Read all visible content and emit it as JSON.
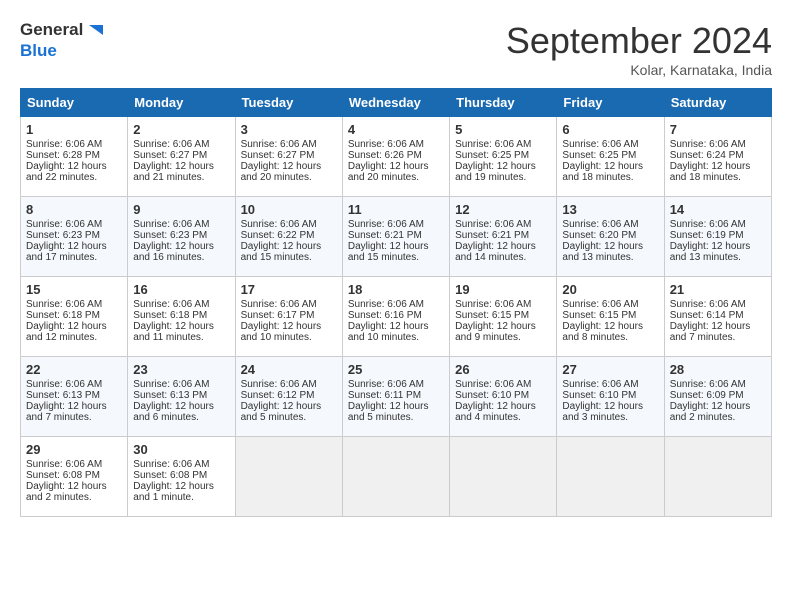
{
  "header": {
    "logo_general": "General",
    "logo_blue": "Blue",
    "month_title": "September 2024",
    "location": "Kolar, Karnataka, India"
  },
  "weekdays": [
    "Sunday",
    "Monday",
    "Tuesday",
    "Wednesday",
    "Thursday",
    "Friday",
    "Saturday"
  ],
  "weeks": [
    [
      {
        "day": "1",
        "lines": [
          "Sunrise: 6:06 AM",
          "Sunset: 6:28 PM",
          "Daylight: 12 hours",
          "and 22 minutes."
        ]
      },
      {
        "day": "2",
        "lines": [
          "Sunrise: 6:06 AM",
          "Sunset: 6:27 PM",
          "Daylight: 12 hours",
          "and 21 minutes."
        ]
      },
      {
        "day": "3",
        "lines": [
          "Sunrise: 6:06 AM",
          "Sunset: 6:27 PM",
          "Daylight: 12 hours",
          "and 20 minutes."
        ]
      },
      {
        "day": "4",
        "lines": [
          "Sunrise: 6:06 AM",
          "Sunset: 6:26 PM",
          "Daylight: 12 hours",
          "and 20 minutes."
        ]
      },
      {
        "day": "5",
        "lines": [
          "Sunrise: 6:06 AM",
          "Sunset: 6:25 PM",
          "Daylight: 12 hours",
          "and 19 minutes."
        ]
      },
      {
        "day": "6",
        "lines": [
          "Sunrise: 6:06 AM",
          "Sunset: 6:25 PM",
          "Daylight: 12 hours",
          "and 18 minutes."
        ]
      },
      {
        "day": "7",
        "lines": [
          "Sunrise: 6:06 AM",
          "Sunset: 6:24 PM",
          "Daylight: 12 hours",
          "and 18 minutes."
        ]
      }
    ],
    [
      {
        "day": "8",
        "lines": [
          "Sunrise: 6:06 AM",
          "Sunset: 6:23 PM",
          "Daylight: 12 hours",
          "and 17 minutes."
        ]
      },
      {
        "day": "9",
        "lines": [
          "Sunrise: 6:06 AM",
          "Sunset: 6:23 PM",
          "Daylight: 12 hours",
          "and 16 minutes."
        ]
      },
      {
        "day": "10",
        "lines": [
          "Sunrise: 6:06 AM",
          "Sunset: 6:22 PM",
          "Daylight: 12 hours",
          "and 15 minutes."
        ]
      },
      {
        "day": "11",
        "lines": [
          "Sunrise: 6:06 AM",
          "Sunset: 6:21 PM",
          "Daylight: 12 hours",
          "and 15 minutes."
        ]
      },
      {
        "day": "12",
        "lines": [
          "Sunrise: 6:06 AM",
          "Sunset: 6:21 PM",
          "Daylight: 12 hours",
          "and 14 minutes."
        ]
      },
      {
        "day": "13",
        "lines": [
          "Sunrise: 6:06 AM",
          "Sunset: 6:20 PM",
          "Daylight: 12 hours",
          "and 13 minutes."
        ]
      },
      {
        "day": "14",
        "lines": [
          "Sunrise: 6:06 AM",
          "Sunset: 6:19 PM",
          "Daylight: 12 hours",
          "and 13 minutes."
        ]
      }
    ],
    [
      {
        "day": "15",
        "lines": [
          "Sunrise: 6:06 AM",
          "Sunset: 6:18 PM",
          "Daylight: 12 hours",
          "and 12 minutes."
        ]
      },
      {
        "day": "16",
        "lines": [
          "Sunrise: 6:06 AM",
          "Sunset: 6:18 PM",
          "Daylight: 12 hours",
          "and 11 minutes."
        ]
      },
      {
        "day": "17",
        "lines": [
          "Sunrise: 6:06 AM",
          "Sunset: 6:17 PM",
          "Daylight: 12 hours",
          "and 10 minutes."
        ]
      },
      {
        "day": "18",
        "lines": [
          "Sunrise: 6:06 AM",
          "Sunset: 6:16 PM",
          "Daylight: 12 hours",
          "and 10 minutes."
        ]
      },
      {
        "day": "19",
        "lines": [
          "Sunrise: 6:06 AM",
          "Sunset: 6:15 PM",
          "Daylight: 12 hours",
          "and 9 minutes."
        ]
      },
      {
        "day": "20",
        "lines": [
          "Sunrise: 6:06 AM",
          "Sunset: 6:15 PM",
          "Daylight: 12 hours",
          "and 8 minutes."
        ]
      },
      {
        "day": "21",
        "lines": [
          "Sunrise: 6:06 AM",
          "Sunset: 6:14 PM",
          "Daylight: 12 hours",
          "and 7 minutes."
        ]
      }
    ],
    [
      {
        "day": "22",
        "lines": [
          "Sunrise: 6:06 AM",
          "Sunset: 6:13 PM",
          "Daylight: 12 hours",
          "and 7 minutes."
        ]
      },
      {
        "day": "23",
        "lines": [
          "Sunrise: 6:06 AM",
          "Sunset: 6:13 PM",
          "Daylight: 12 hours",
          "and 6 minutes."
        ]
      },
      {
        "day": "24",
        "lines": [
          "Sunrise: 6:06 AM",
          "Sunset: 6:12 PM",
          "Daylight: 12 hours",
          "and 5 minutes."
        ]
      },
      {
        "day": "25",
        "lines": [
          "Sunrise: 6:06 AM",
          "Sunset: 6:11 PM",
          "Daylight: 12 hours",
          "and 5 minutes."
        ]
      },
      {
        "day": "26",
        "lines": [
          "Sunrise: 6:06 AM",
          "Sunset: 6:10 PM",
          "Daylight: 12 hours",
          "and 4 minutes."
        ]
      },
      {
        "day": "27",
        "lines": [
          "Sunrise: 6:06 AM",
          "Sunset: 6:10 PM",
          "Daylight: 12 hours",
          "and 3 minutes."
        ]
      },
      {
        "day": "28",
        "lines": [
          "Sunrise: 6:06 AM",
          "Sunset: 6:09 PM",
          "Daylight: 12 hours",
          "and 2 minutes."
        ]
      }
    ],
    [
      {
        "day": "29",
        "lines": [
          "Sunrise: 6:06 AM",
          "Sunset: 6:08 PM",
          "Daylight: 12 hours",
          "and 2 minutes."
        ]
      },
      {
        "day": "30",
        "lines": [
          "Sunrise: 6:06 AM",
          "Sunset: 6:08 PM",
          "Daylight: 12 hours",
          "and 1 minute."
        ]
      },
      {
        "day": "",
        "lines": []
      },
      {
        "day": "",
        "lines": []
      },
      {
        "day": "",
        "lines": []
      },
      {
        "day": "",
        "lines": []
      },
      {
        "day": "",
        "lines": []
      }
    ]
  ]
}
